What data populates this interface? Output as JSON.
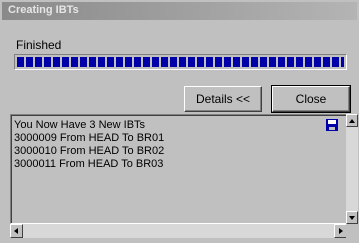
{
  "window": {
    "title": "Creating IBTs"
  },
  "status": {
    "text": "Finished",
    "progress_percent": 100
  },
  "buttons": {
    "details_label": "Details <<",
    "close_label": "Close"
  },
  "log": {
    "lines": [
      "You Now Have 3 New IBTs",
      "3000009 From HEAD To BR01",
      "3000010 From HEAD To BR02",
      "3000011 From HEAD To BR03"
    ],
    "icon": "floppy-disk-icon"
  },
  "colors": {
    "progress": "#0000a8",
    "face": "#c0c0c0",
    "title_bar": "#8a8a8a"
  }
}
